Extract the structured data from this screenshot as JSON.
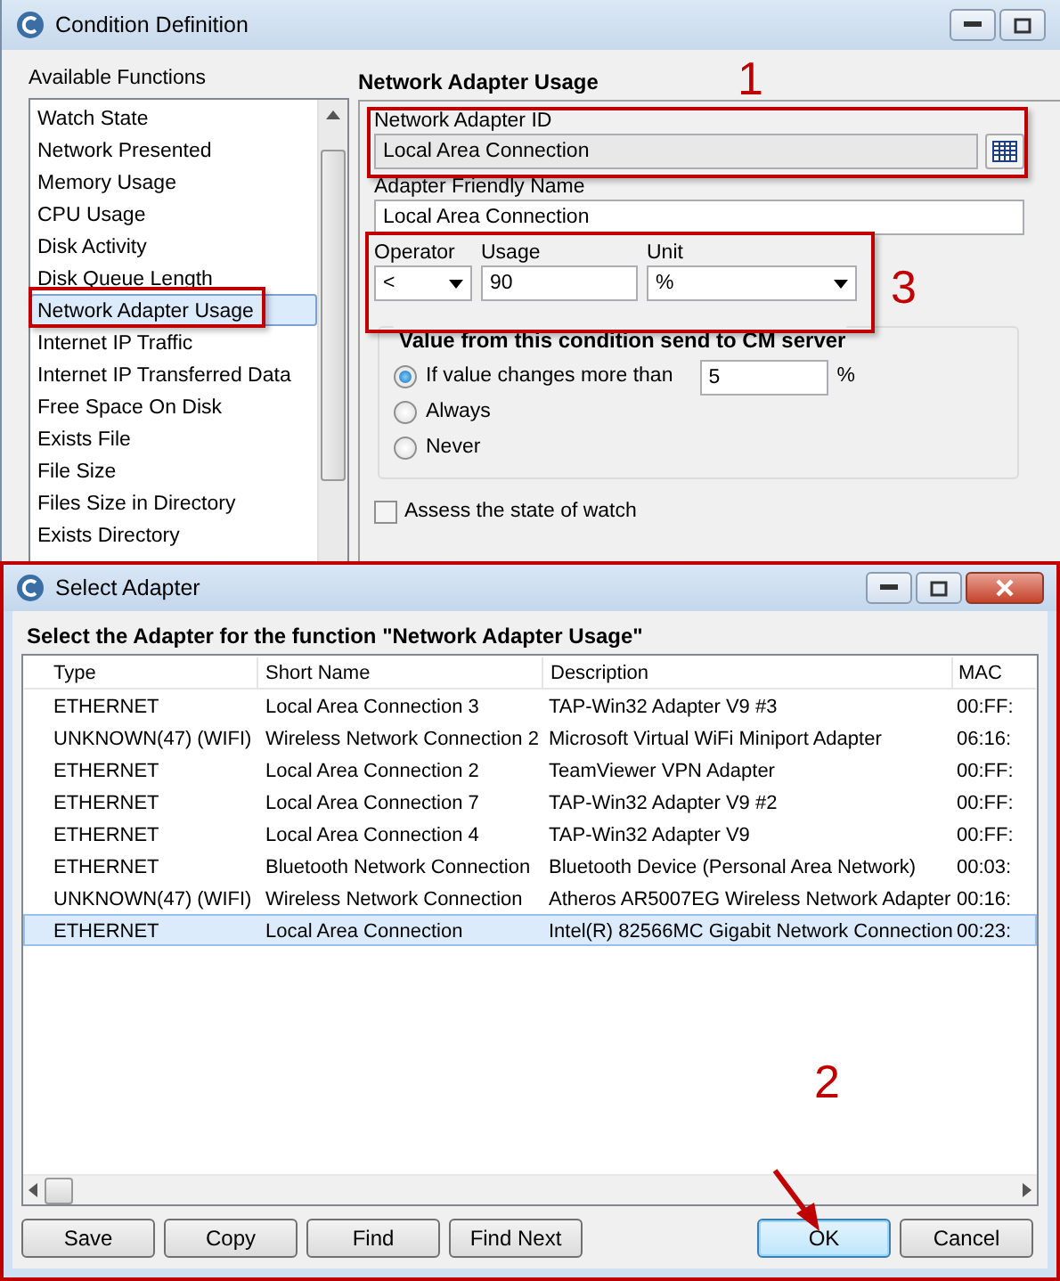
{
  "main_window": {
    "title": "Condition Definition",
    "functions_label": "Available Functions",
    "functions": [
      {
        "label": "Watch State",
        "selected": false
      },
      {
        "label": "Network Presented",
        "selected": false
      },
      {
        "label": "Memory Usage",
        "selected": false
      },
      {
        "label": "CPU Usage",
        "selected": false
      },
      {
        "label": "Disk Activity",
        "selected": false
      },
      {
        "label": "Disk Queue Length",
        "selected": false
      },
      {
        "label": "Network Adapter Usage",
        "selected": true
      },
      {
        "label": "Internet IP Traffic",
        "selected": false
      },
      {
        "label": "Internet IP Transferred Data",
        "selected": false
      },
      {
        "label": "Free Space On Disk",
        "selected": false
      },
      {
        "label": "Exists File",
        "selected": false
      },
      {
        "label": "File Size",
        "selected": false
      },
      {
        "label": "Files Size in Directory",
        "selected": false
      },
      {
        "label": "Exists Directory",
        "selected": false
      }
    ],
    "panel_title": "Network Adapter Usage",
    "adapter_id": {
      "label": "Network Adapter ID",
      "value": "Local Area Connection"
    },
    "friendly_name": {
      "label": "Adapter Friendly Name",
      "value": "Local Area Connection"
    },
    "operator": {
      "label": "Operator",
      "value": "<"
    },
    "usage": {
      "label": "Usage",
      "value": "90"
    },
    "unit": {
      "label": "Unit",
      "value": "%"
    },
    "send_group": {
      "title": "Value from this condition send to CM server",
      "options": [
        {
          "label": "If value changes more than",
          "selected": true
        },
        {
          "label": "Always",
          "selected": false
        },
        {
          "label": "Never",
          "selected": false
        }
      ],
      "threshold": "5",
      "threshold_unit": "%"
    },
    "assess": {
      "label": "Assess the state of watch",
      "checked": false
    }
  },
  "dialog": {
    "title": "Select Adapter",
    "heading": "Select the Adapter for the function \"Network Adapter Usage\"",
    "columns": [
      "Type",
      "Short Name",
      "Description",
      "MAC"
    ],
    "rows": [
      {
        "cells": [
          "ETHERNET",
          "Local Area Connection 3",
          "TAP-Win32 Adapter V9 #3",
          "00:FF:"
        ],
        "selected": false
      },
      {
        "cells": [
          "UNKNOWN(47) (WIFI)",
          "Wireless Network Connection 2",
          "Microsoft Virtual WiFi Miniport Adapter",
          "06:16:"
        ],
        "selected": false
      },
      {
        "cells": [
          "ETHERNET",
          "Local Area Connection 2",
          "TeamViewer VPN Adapter",
          "00:FF:"
        ],
        "selected": false
      },
      {
        "cells": [
          "ETHERNET",
          "Local Area Connection 7",
          "TAP-Win32 Adapter V9 #2",
          "00:FF:"
        ],
        "selected": false
      },
      {
        "cells": [
          "ETHERNET",
          "Local Area Connection 4",
          "TAP-Win32 Adapter V9",
          "00:FF:"
        ],
        "selected": false
      },
      {
        "cells": [
          "ETHERNET",
          "Bluetooth Network Connection",
          "Bluetooth Device (Personal Area Network)",
          "00:03:"
        ],
        "selected": false
      },
      {
        "cells": [
          "UNKNOWN(47) (WIFI)",
          "Wireless Network Connection",
          "Atheros AR5007EG Wireless Network Adapter",
          "00:16:"
        ],
        "selected": false
      },
      {
        "cells": [
          "ETHERNET",
          "Local Area Connection",
          "Intel(R) 82566MC Gigabit Network Connection",
          "00:23:"
        ],
        "selected": true
      }
    ],
    "buttons": [
      {
        "label": "Save",
        "default": false
      },
      {
        "label": "Copy",
        "default": false
      },
      {
        "label": "Find",
        "default": false
      },
      {
        "label": "Find Next",
        "default": false
      },
      {
        "label": "OK",
        "default": true
      },
      {
        "label": "Cancel",
        "default": false
      }
    ]
  },
  "callouts": [
    "1",
    "3",
    "2"
  ]
}
